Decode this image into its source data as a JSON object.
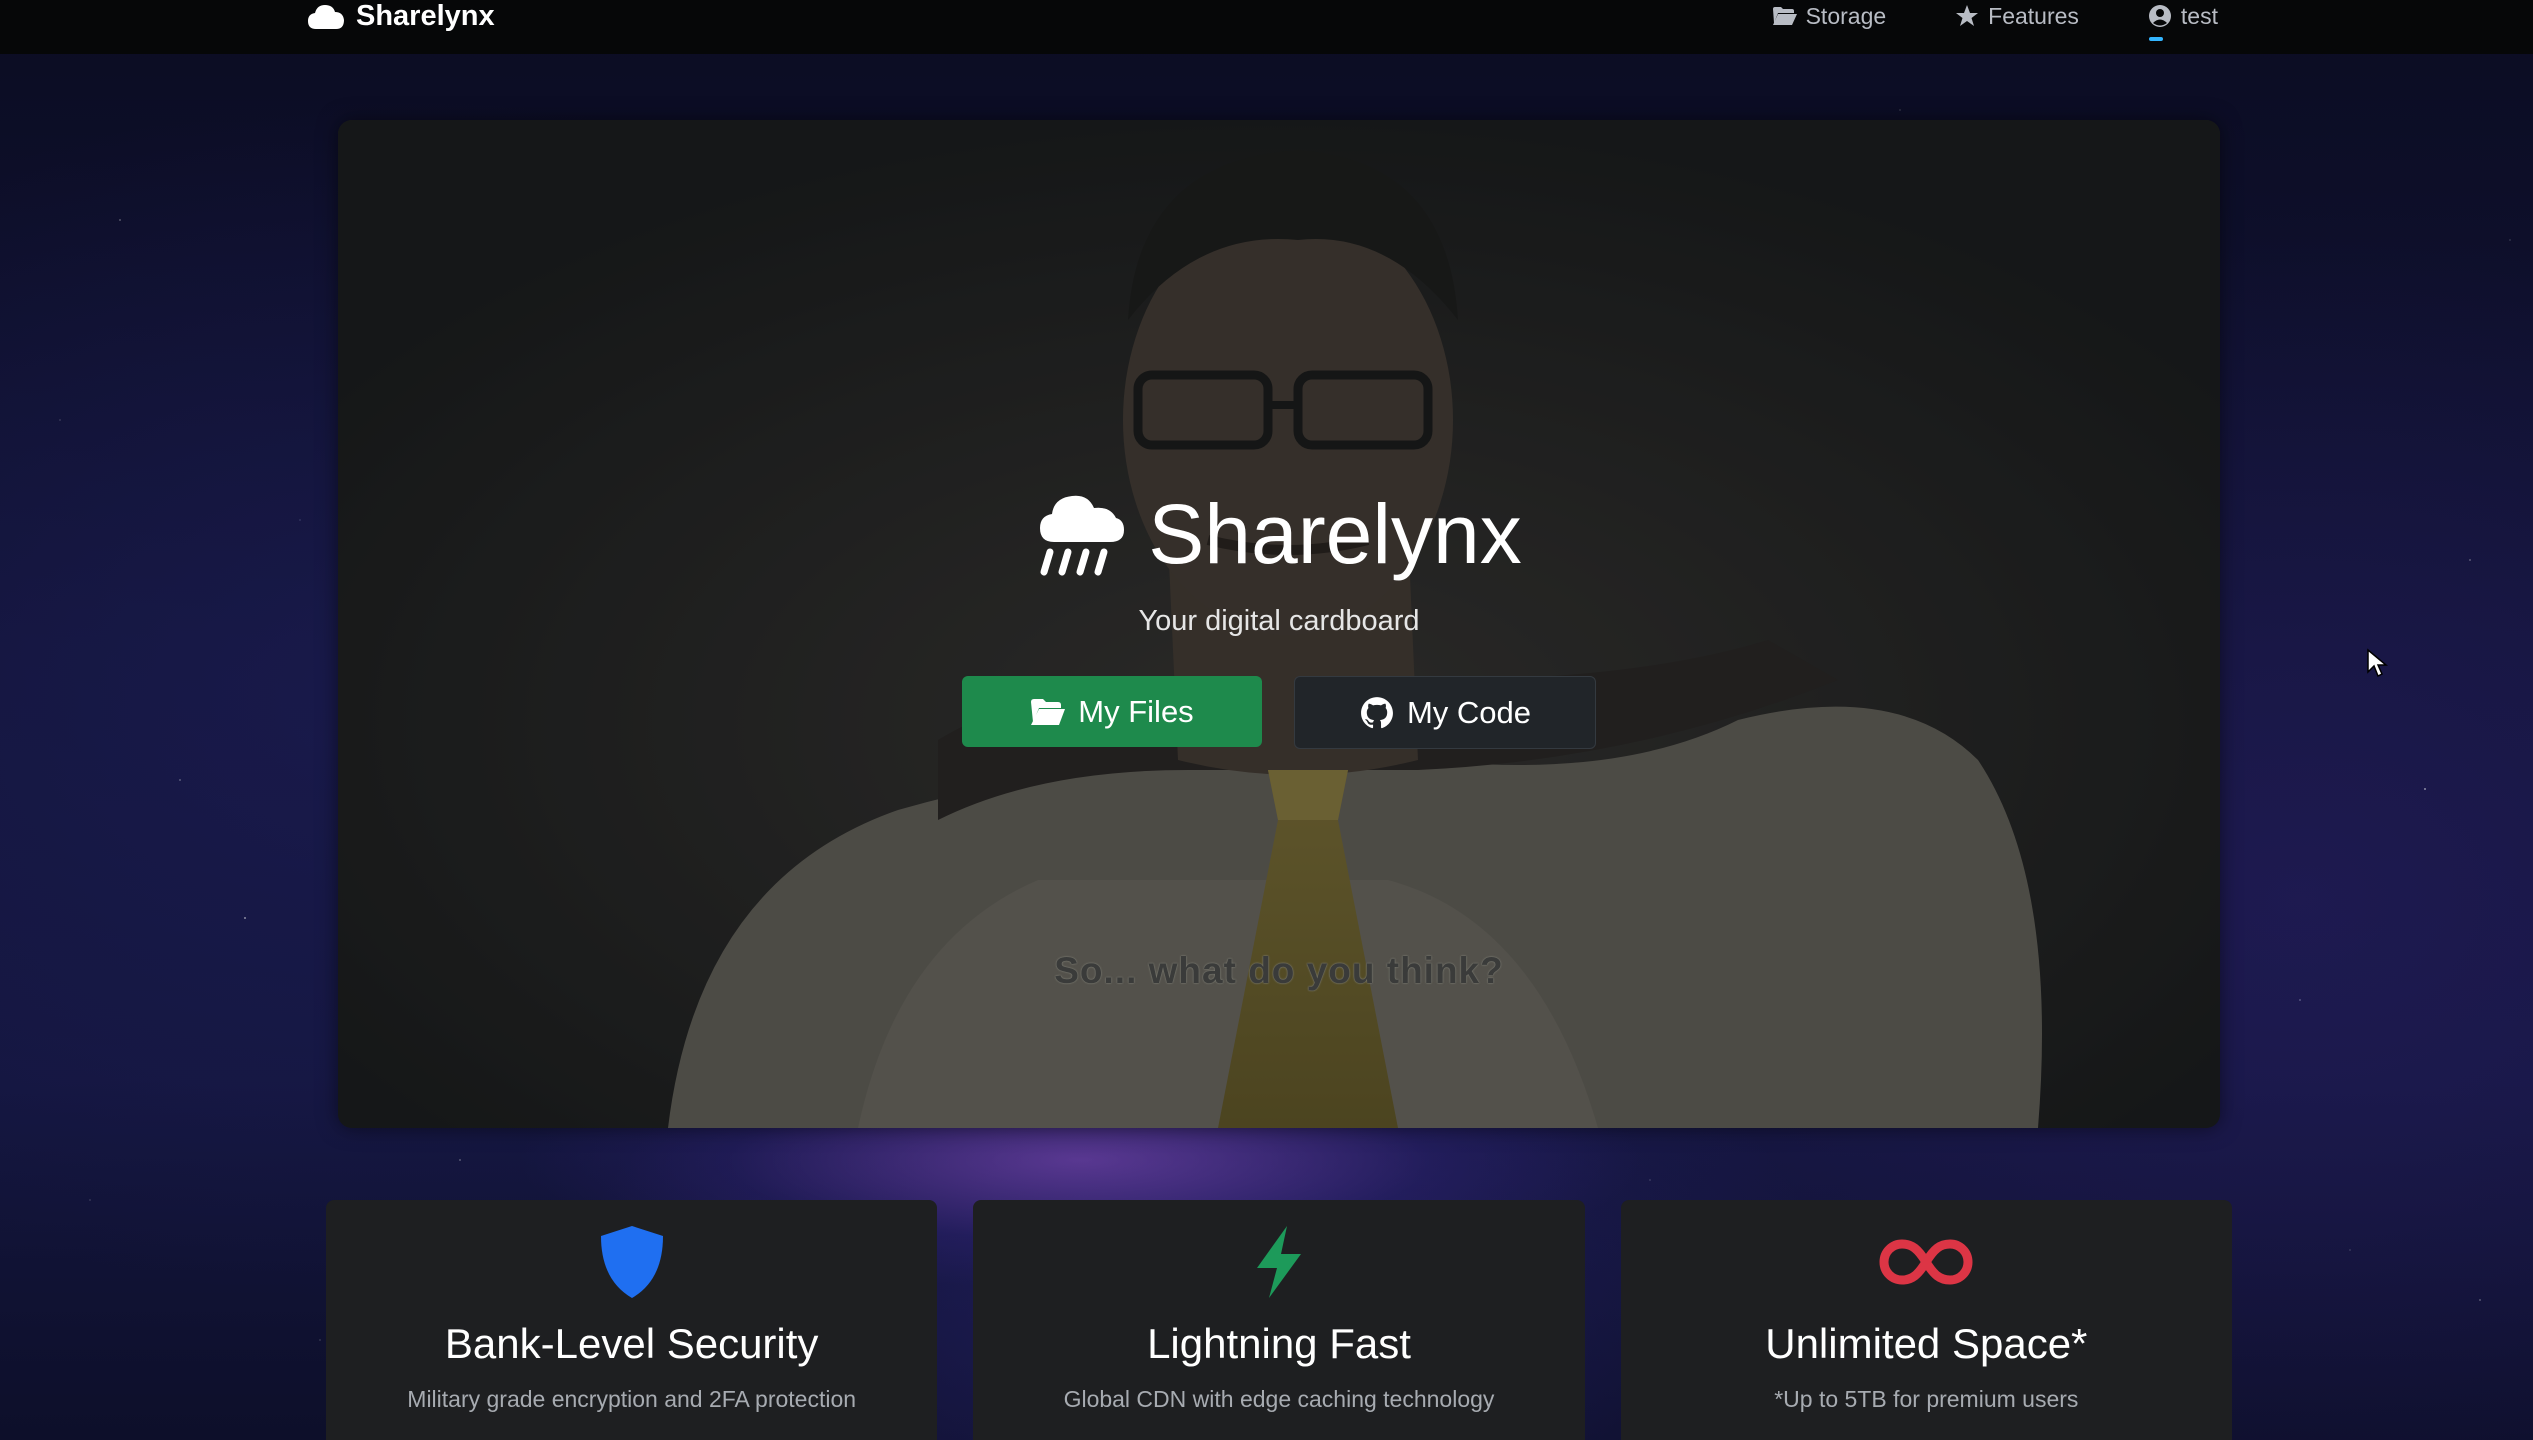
{
  "navbar": {
    "brand": "Sharelynx",
    "links": [
      {
        "label": "Storage",
        "icon": "folder-open-icon"
      },
      {
        "label": "Features",
        "icon": "star-icon"
      },
      {
        "label": "test",
        "icon": "user-circle-icon"
      }
    ]
  },
  "hero": {
    "title": "Sharelynx",
    "tagline": "Your digital cardboard",
    "caption": "So... what do you think?",
    "buttons": {
      "files": "My Files",
      "code": "My Code"
    }
  },
  "features": [
    {
      "title": "Bank-Level Security",
      "desc": "Military grade encryption and 2FA protection",
      "icon": "shield-icon",
      "color": "#1f6ff1"
    },
    {
      "title": "Lightning Fast",
      "desc": "Global CDN with edge caching technology",
      "icon": "bolt-icon",
      "color": "#1d9a5a"
    },
    {
      "title": "Unlimited Space*",
      "desc": "*Up to 5TB for premium users",
      "icon": "infinity-icon",
      "color": "#dc3545"
    }
  ]
}
